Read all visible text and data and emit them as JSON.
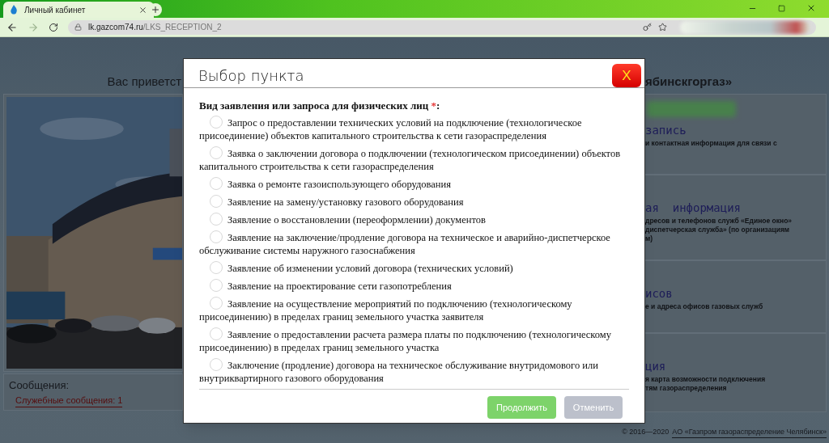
{
  "browser": {
    "tab": {
      "title": "Личный кабинет"
    },
    "address": {
      "host": "lk.gazcom74.ru",
      "path": "/LKS_RECEPTION_2"
    }
  },
  "page": {
    "greeting_left": "Вас приветст",
    "greeting_right": "ябинскгоргаз»",
    "messages": {
      "title": "Сообщения:",
      "link": "Служебные сообщения: 1"
    },
    "cards": [
      {
        "title": "запись",
        "lines": [
          "и контактная информация для связи с"
        ]
      },
      {
        "title": "ая  информация",
        "lines": [
          "дресов и телефонов служб «Единое окно»",
          "диспетчерская служба» (по организациям",
          "м)"
        ]
      },
      {
        "title": "исов",
        "lines": [
          "е и адреса офисов газовых служб"
        ]
      },
      {
        "title": "ция",
        "lines": [
          "я карта возможности подключения",
          "тям газораспределения"
        ]
      }
    ],
    "footer": {
      "copyright": "© 2016—2020",
      "company": "АО «Газпром газораспределение Челябинск»"
    }
  },
  "dialog": {
    "title": "Выбор пункта",
    "close": "X",
    "question": "Вид заявления или запроса для физических лиц",
    "required_mark": "*",
    "question_end": ":",
    "options": [
      {
        "label": "Запрос о предоставлении технических условий на подключение (технологическое присоединение) объектов капитального строительства к сети газораспределения",
        "selected": false
      },
      {
        "label": "Заявка о заключении договора о подключении (технологическом присоединении) объектов капитального строительства к сети газораспределения",
        "selected": false
      },
      {
        "label": "Заявка о ремонте газоиспользующего оборудования",
        "selected": false
      },
      {
        "label": "Заявление на замену/установку газового оборудования",
        "selected": false
      },
      {
        "label": "Заявление о восстановлении (переоформлении) документов",
        "selected": false
      },
      {
        "label": "Заявление на заключение/продление договора на техническое и аварийно-диспетчерское обслуживание системы наружного газоснабжения",
        "selected": false
      },
      {
        "label": "Заявление об изменении условий договора (технических условий)",
        "selected": false
      },
      {
        "label": "Заявление на проектирование сети газопотребления",
        "selected": false
      },
      {
        "label": "Заявление на осуществление мероприятий по подключению (технологическому присоединению) в пределах границ земельного участка заявителя",
        "selected": false
      },
      {
        "label": "Заявление о предоставлении расчета размера платы по подключению (технологическому присоединению) в пределах границ земельного участка",
        "selected": false
      },
      {
        "label": "Заключение (продление) договора на техническое обслуживание внутридомового или внутриквартирного газового оборудования",
        "selected": false
      }
    ],
    "buttons": [
      {
        "label": "Продолжить",
        "kind": "primary"
      },
      {
        "label": "Отменить",
        "kind": "secondary"
      }
    ]
  }
}
